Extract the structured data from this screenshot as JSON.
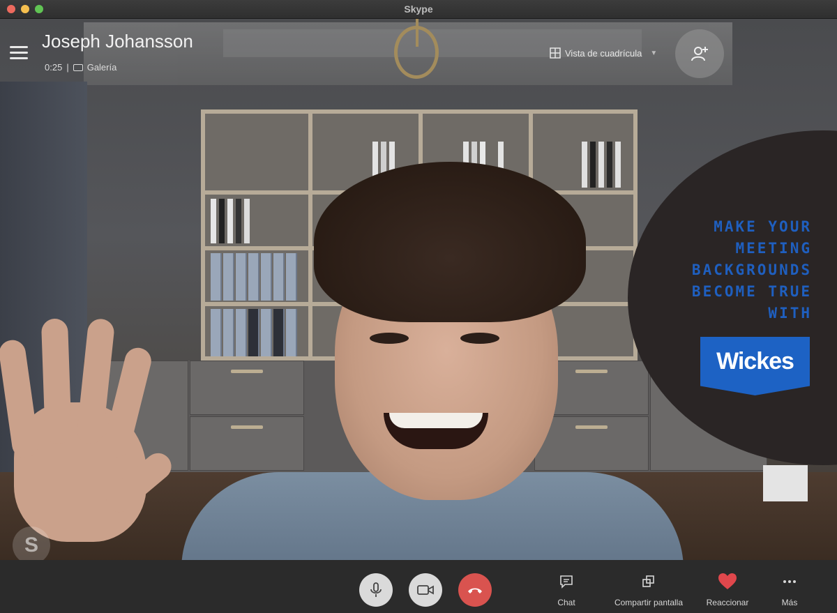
{
  "window": {
    "title": "Skype"
  },
  "call": {
    "caller_name": "Joseph Johansson",
    "duration": "0:25",
    "separator": "|",
    "layout_mode": "Galería",
    "view_selector": "Vista de cuadrícula"
  },
  "ad": {
    "lines": [
      "MAKE YOUR",
      "MEETING",
      "BACKGROUNDS",
      "BECOME TRUE",
      "WITH"
    ],
    "brand": "Wickes",
    "text_color": "#1f5fbf",
    "brand_color": "#1d62c4"
  },
  "controls": {
    "chat": "Chat",
    "share_screen": "Compartir pantalla",
    "react": "Reaccionar",
    "more": "Más"
  },
  "colors": {
    "end_call": "#d9534f",
    "heart": "#e0474c"
  }
}
